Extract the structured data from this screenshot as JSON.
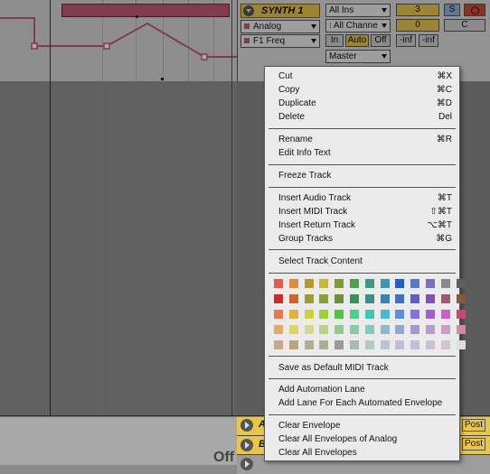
{
  "colors": {
    "clip": "#c15a76",
    "track_yellow": "#e8c54d",
    "solo_blue": "#8fb4de",
    "arm_red": "#d04a3a"
  },
  "track": {
    "title": "SYNTH 1",
    "device_select": "Analog",
    "param_select": "F1 Freq",
    "input_type": "All Ins",
    "input_channel": "All Channe",
    "monitor": [
      "In",
      "Auto",
      "Off"
    ],
    "output": "Master",
    "track_number": "3",
    "solo": "S",
    "send_value": "0",
    "pan": "C",
    "vol_left": "-inf",
    "vol_right": "-inf"
  },
  "bottom_tracks": [
    {
      "letter": "A",
      "post": "Post"
    },
    {
      "letter": "B",
      "post": "Post"
    }
  ],
  "bottom_text": "Off",
  "menu": {
    "group1": [
      {
        "label": "Cut",
        "shortcut": "⌘X"
      },
      {
        "label": "Copy",
        "shortcut": "⌘C"
      },
      {
        "label": "Duplicate",
        "shortcut": "⌘D"
      },
      {
        "label": "Delete",
        "shortcut": "Del"
      }
    ],
    "group2": [
      {
        "label": "Rename",
        "shortcut": "⌘R"
      },
      {
        "label": "Edit Info Text",
        "shortcut": ""
      }
    ],
    "group3": [
      {
        "label": "Freeze Track",
        "shortcut": ""
      }
    ],
    "group4": [
      {
        "label": "Insert Audio Track",
        "shortcut": "⌘T"
      },
      {
        "label": "Insert MIDI Track",
        "shortcut": "⇧⌘T"
      },
      {
        "label": "Insert Return Track",
        "shortcut": "⌥⌘T"
      },
      {
        "label": "Group Tracks",
        "shortcut": "⌘G"
      }
    ],
    "group5": [
      {
        "label": "Select Track Content",
        "shortcut": ""
      }
    ],
    "palette": [
      [
        "#e15c4c",
        "#e28a3a",
        "#b8972e",
        "#c7b63a",
        "#7f9a37",
        "#4fa04f",
        "#3d9a88",
        "#3c97b3",
        "#1f5fd6",
        "#5a78c8",
        "#7a6fb8",
        "#8b8b8b",
        "#5f5f5f"
      ],
      [
        "#c82e2a",
        "#c9662e",
        "#9c9a3b",
        "#8e9c3e",
        "#6d8f3f",
        "#3f8f5b",
        "#3f8e87",
        "#3a82b0",
        "#456fc0",
        "#5e62b8",
        "#7e55a8",
        "#9e5a74",
        "#845a40"
      ],
      [
        "#e8774a",
        "#e5b03c",
        "#cfd13a",
        "#9bd03a",
        "#54c24a",
        "#4dd08a",
        "#45c6b4",
        "#48b7d8",
        "#5f8de0",
        "#8272dc",
        "#a35fd0",
        "#cc5cc6",
        "#c4487a"
      ],
      [
        "#e3a86a",
        "#ded169",
        "#d6d88e",
        "#b7d38a",
        "#93c98a",
        "#8ec9a4",
        "#86c8b9",
        "#8dbacb",
        "#93a7cf",
        "#a49ad0",
        "#b99ad0",
        "#cf9ac4",
        "#cd8da0"
      ],
      [
        "#c7a48a",
        "#b9a47b",
        "#aeae92",
        "#a6b18f",
        "#9a9a9a",
        "#a9bcac",
        "#b5c9c4",
        "#b9c6cd",
        "#bdbfd6",
        "#c5bdd6",
        "#cfbfd3",
        "#d3c5c9",
        "#dedede"
      ]
    ],
    "group6": [
      {
        "label": "Save as Default MIDI Track",
        "shortcut": ""
      }
    ],
    "group7": [
      {
        "label": "Add Automation Lane",
        "shortcut": ""
      },
      {
        "label": "Add Lane For Each Automated Envelope",
        "shortcut": ""
      }
    ],
    "group8": [
      {
        "label": "Clear Envelope",
        "shortcut": ""
      },
      {
        "label": "Clear All Envelopes of Analog",
        "shortcut": ""
      },
      {
        "label": "Clear All Envelopes",
        "shortcut": ""
      }
    ]
  }
}
